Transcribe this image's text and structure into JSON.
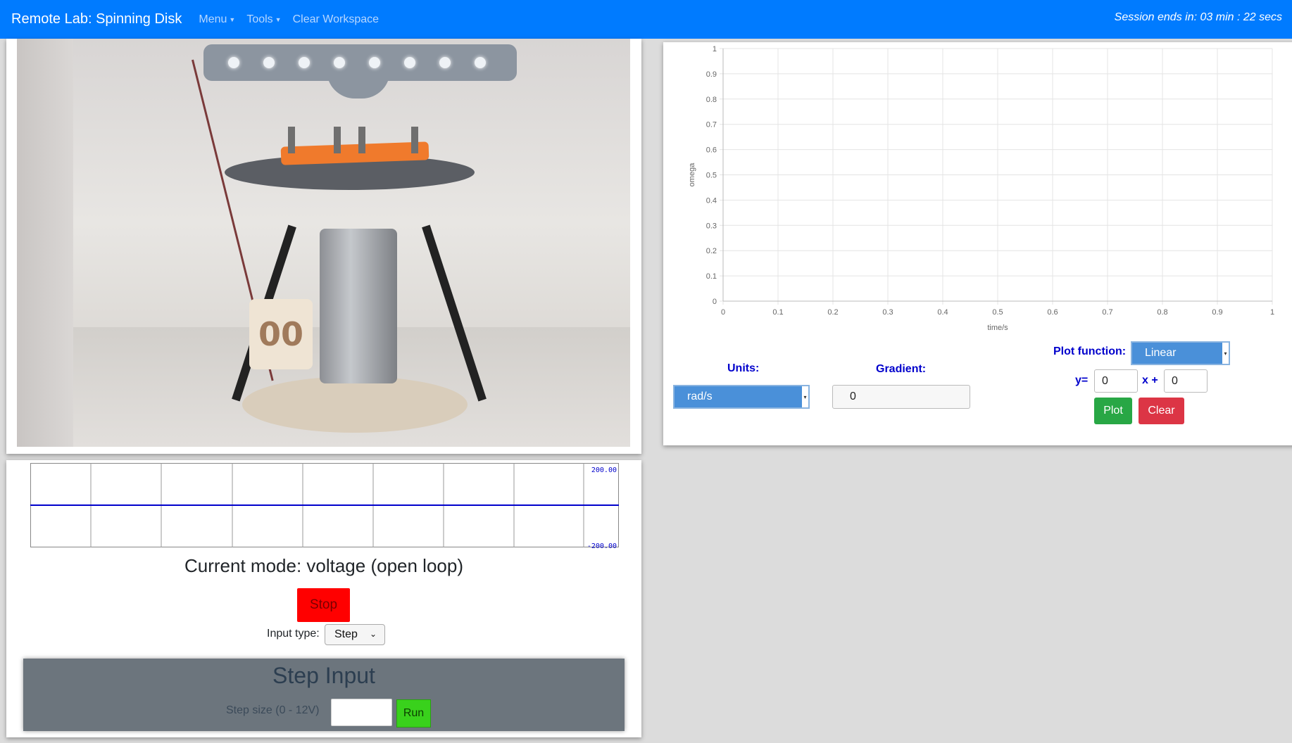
{
  "navbar": {
    "brand": "Remote Lab: Spinning Disk",
    "menu_label": "Menu",
    "tools_label": "Tools",
    "clear_workspace_label": "Clear Workspace",
    "session_text": "Session ends in: 03 min : 22 secs"
  },
  "video": {
    "tag_text": "00"
  },
  "plot": {
    "units_label": "Units:",
    "units_value": "rad/s",
    "gradient_label": "Gradient:",
    "gradient_value": "0",
    "plot_function_label": "Plot function:",
    "plot_function_value": "Linear",
    "y_label": "y=",
    "y_value": "0",
    "x_label": "x +",
    "x_value": "0",
    "plot_button": "Plot",
    "clear_button": "Clear"
  },
  "chart_data": {
    "type": "line",
    "xlabel": "time/s",
    "ylabel": "omega",
    "xlim": [
      0,
      1
    ],
    "ylim": [
      0,
      1
    ],
    "x_ticks": [
      "0",
      "0.1",
      "0.2",
      "0.3",
      "0.4",
      "0.5",
      "0.6",
      "0.7",
      "0.8",
      "0.9",
      "1"
    ],
    "y_ticks": [
      "0",
      "0.1",
      "0.2",
      "0.3",
      "0.4",
      "0.5",
      "0.6",
      "0.7",
      "0.8",
      "0.9",
      "1"
    ],
    "grid": true,
    "series": []
  },
  "strip_chart": {
    "max_label": "200.00",
    "min_label": "-200.00",
    "value": 0,
    "line_color": "#0000cc"
  },
  "control": {
    "mode_text": "Current mode: voltage (open loop)",
    "stop_button": "Stop",
    "input_type_label": "Input type:",
    "input_type_value": "Step",
    "step_title": "Step Input",
    "step_size_label": "Step size (0 - 12V)",
    "step_size_value": "",
    "run_button": "Run"
  },
  "colors": {
    "navbar": "#007bff",
    "stop": "#ff0000",
    "run": "#39d11c",
    "plot_btn": "#28a745",
    "clear_btn": "#dc3545",
    "select": "#4a90d9"
  }
}
